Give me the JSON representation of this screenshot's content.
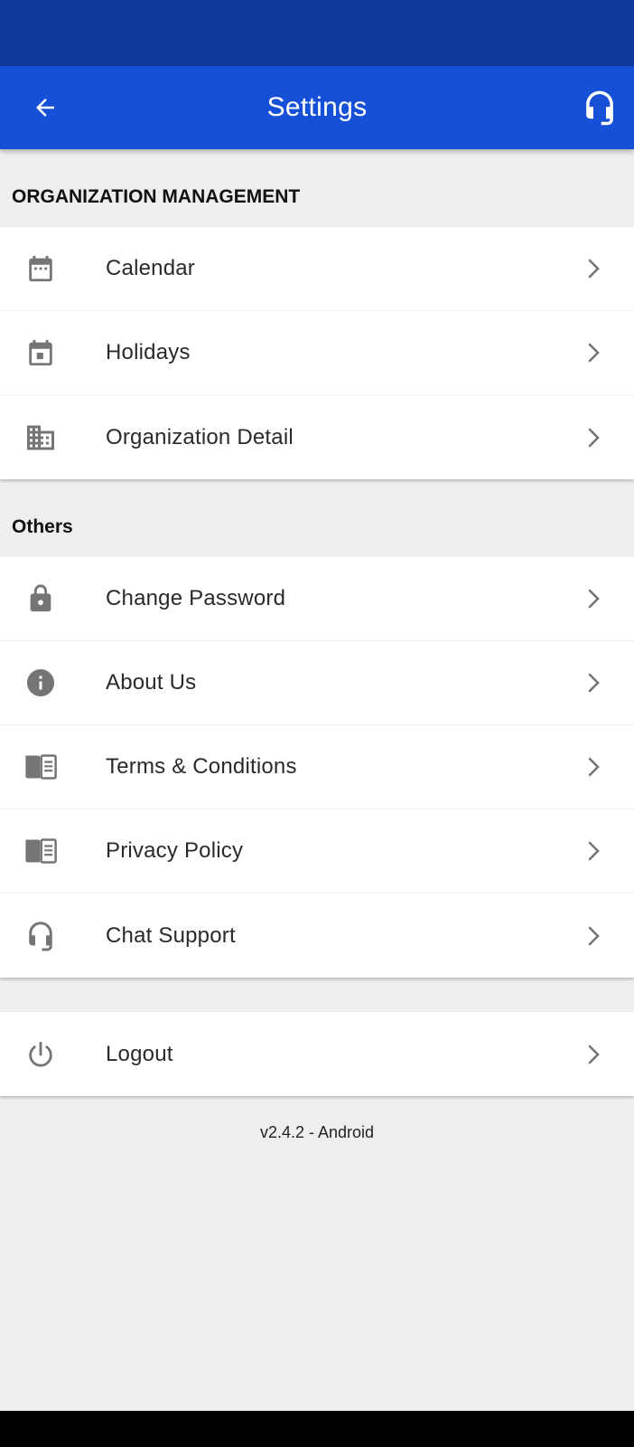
{
  "appbar": {
    "title": "Settings",
    "back_icon": "arrow-left-icon",
    "support_icon": "headset-icon"
  },
  "sections": [
    {
      "header": "ORGANIZATION MANAGEMENT",
      "items": [
        {
          "label": "Calendar",
          "icon": "calendar-icon"
        },
        {
          "label": "Holidays",
          "icon": "calendar-event-icon"
        },
        {
          "label": "Organization Detail",
          "icon": "building-icon"
        }
      ]
    },
    {
      "header": "Others",
      "items": [
        {
          "label": "Change Password",
          "icon": "lock-icon"
        },
        {
          "label": "About Us",
          "icon": "info-icon"
        },
        {
          "label": "Terms & Conditions",
          "icon": "document-icon"
        },
        {
          "label": "Privacy Policy",
          "icon": "document-icon"
        },
        {
          "label": "Chat Support",
          "icon": "headset-icon"
        }
      ]
    }
  ],
  "logout": {
    "label": "Logout",
    "icon": "power-icon"
  },
  "version": "v2.4.2 - Android",
  "colors": {
    "statusbar": "#0d3a9c",
    "appbar": "#1650d6",
    "background": "#eeeeee",
    "icon": "#757575"
  }
}
